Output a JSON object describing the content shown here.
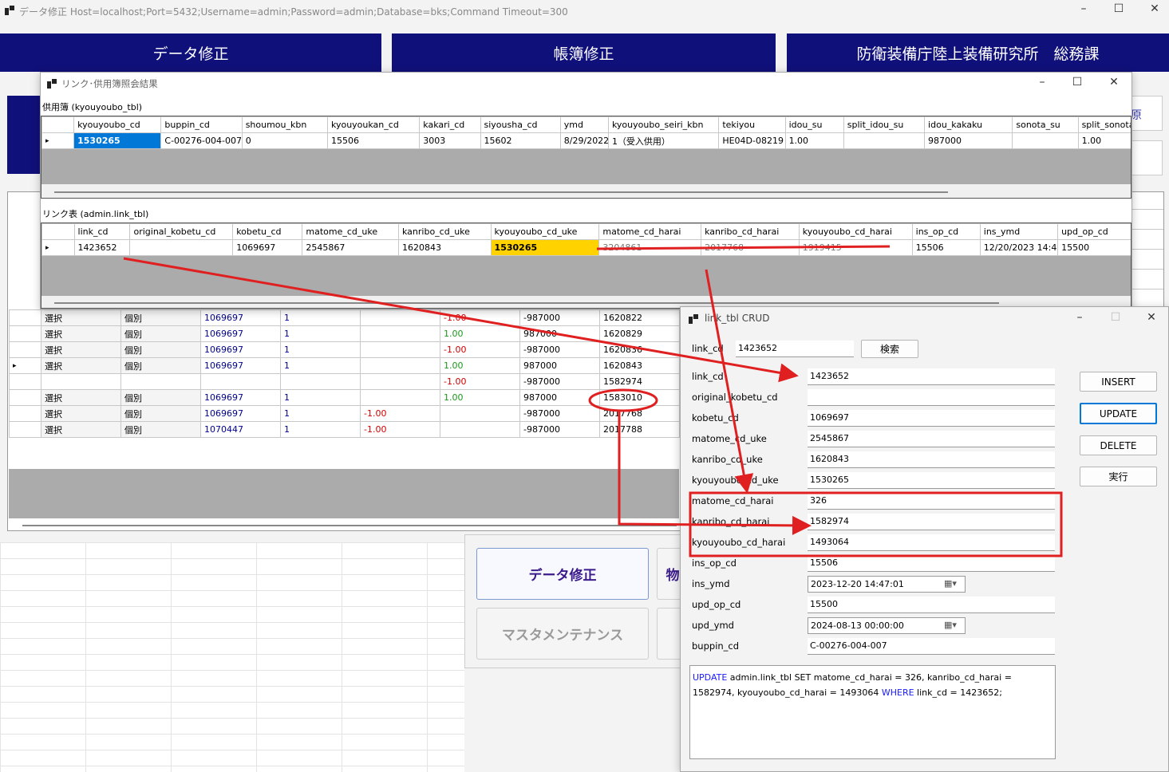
{
  "main": {
    "title": "データ修正 Host=localhost;Port=5432;Username=admin;Password=admin;Database=bks;Command Timeout=300",
    "nav": [
      "データ修正",
      "帳簿修正",
      "防衛装備庁陸上装備研究所　総務課"
    ],
    "menu_buttons": [
      "データ修正",
      "物",
      "マスタメンテナンス"
    ],
    "right_fragment": "原",
    "kbn_fragment": "kbn"
  },
  "bg_grid": {
    "rows": [
      {
        "sel": "選択",
        "kind": "個別",
        "kobetu": "1069697",
        "n": "1",
        "a": "",
        "b": "-1.00",
        "c": "-987000",
        "d": "1620822"
      },
      {
        "sel": "選択",
        "kind": "個別",
        "kobetu": "1069697",
        "n": "1",
        "a": "",
        "b": "1.00",
        "c": "987000",
        "d": "1620829"
      },
      {
        "sel": "選択",
        "kind": "個別",
        "kobetu": "1069697",
        "n": "1",
        "a": "",
        "b": "-1.00",
        "c": "-987000",
        "d": "1620836"
      },
      {
        "sel": "選択",
        "kind": "個別",
        "kobetu": "1069697",
        "n": "1",
        "a": "",
        "b": "1.00",
        "c": "987000",
        "d": "1620843"
      },
      {
        "sel": "",
        "kind": "",
        "kobetu": "",
        "n": "",
        "a": "",
        "b": "-1.00",
        "c": "-987000",
        "d": "1582974"
      },
      {
        "sel": "選択",
        "kind": "個別",
        "kobetu": "1069697",
        "n": "1",
        "a": "",
        "b": "1.00",
        "c": "987000",
        "d": "1583010"
      },
      {
        "sel": "選択",
        "kind": "個別",
        "kobetu": "1069697",
        "n": "1",
        "a": "-1.00",
        "b": "",
        "c": "-987000",
        "d": "2017768"
      },
      {
        "sel": "選択",
        "kind": "個別",
        "kobetu": "1070447",
        "n": "1",
        "a": "-1.00",
        "b": "",
        "c": "-987000",
        "d": "2017788"
      }
    ]
  },
  "link_window": {
    "title": "リンク･供用簿照会結果",
    "table1_caption": "供用簿 (kyouyoubo_tbl)",
    "table1_headers": [
      "kyouyoubo_cd",
      "buppin_cd",
      "shoumou_kbn",
      "kyouyoukan_cd",
      "kakari_cd",
      "siyousha_cd",
      "ymd",
      "kyouyoubo_seiri_kbn",
      "tekiyou",
      "idou_su",
      "split_idou_su",
      "idou_kakaku",
      "sonota_su",
      "split_sonota_su"
    ],
    "table1_row": [
      "1530265",
      "C-00276-004-007",
      "0",
      "15506",
      "3003",
      "15602",
      "8/29/2022",
      "1（受入供用）",
      "HE04D-08219",
      "1.00",
      "",
      "987000",
      "",
      "1.00"
    ],
    "table2_caption": "リンク表 (admin.link_tbl)",
    "table2_headers": [
      "link_cd",
      "original_kobetu_cd",
      "kobetu_cd",
      "matome_cd_uke",
      "kanribo_cd_uke",
      "kyouyoubo_cd_uke",
      "matome_cd_harai",
      "kanribo_cd_harai",
      "kyouyoubo_cd_harai",
      "ins_op_cd",
      "ins_ymd",
      "upd_op_cd",
      "u"
    ],
    "table2_row": [
      "1423652",
      "",
      "1069697",
      "2545867",
      "1620843",
      "1530265",
      "3204861",
      "2017768",
      "1919415",
      "15506",
      "12/20/2023 14:47",
      "15500",
      "8/"
    ]
  },
  "crud": {
    "title": "link_tbl CRUD",
    "search_label": "link_cd",
    "search_value": "1423652",
    "search_button": "検索",
    "fields": [
      {
        "label": "link_cd",
        "value": "1423652"
      },
      {
        "label": "original_kobetu_cd",
        "value": ""
      },
      {
        "label": "kobetu_cd",
        "value": "1069697"
      },
      {
        "label": "matome_cd_uke",
        "value": "2545867"
      },
      {
        "label": "kanribo_cd_uke",
        "value": "1620843"
      },
      {
        "label": "kyouyoubo_cd_uke",
        "value": "1530265"
      },
      {
        "label": "matome_cd_harai",
        "value": "326"
      },
      {
        "label": "kanribo_cd_harai",
        "value": "1582974"
      },
      {
        "label": "kyouyoubo_cd_harai",
        "value": "1493064"
      },
      {
        "label": "ins_op_cd",
        "value": "15506"
      },
      {
        "label": "ins_ymd",
        "value": "2023-12-20 14:47:01"
      },
      {
        "label": "upd_op_cd",
        "value": "15500"
      },
      {
        "label": "upd_ymd",
        "value": "2024-08-13 00:00:00"
      },
      {
        "label": "buppin_cd",
        "value": "C-00276-004-007"
      }
    ],
    "buttons": [
      "INSERT",
      "UPDATE",
      "DELETE",
      "実行"
    ],
    "sql_kw1": "UPDATE",
    "sql_mid": " admin.link_tbl SET matome_cd_harai = 326, kanribo_cd_harai = 1582974, kyouyoubo_cd_harai = 1493064 ",
    "sql_kw2": "WHERE",
    "sql_end": " link_cd = 1423652;"
  },
  "colors": {
    "nav_bg": "#10107a",
    "annotation_red": "#e02020",
    "highlight_yellow": "#ffd200",
    "selected_blue": "#0078d7"
  }
}
